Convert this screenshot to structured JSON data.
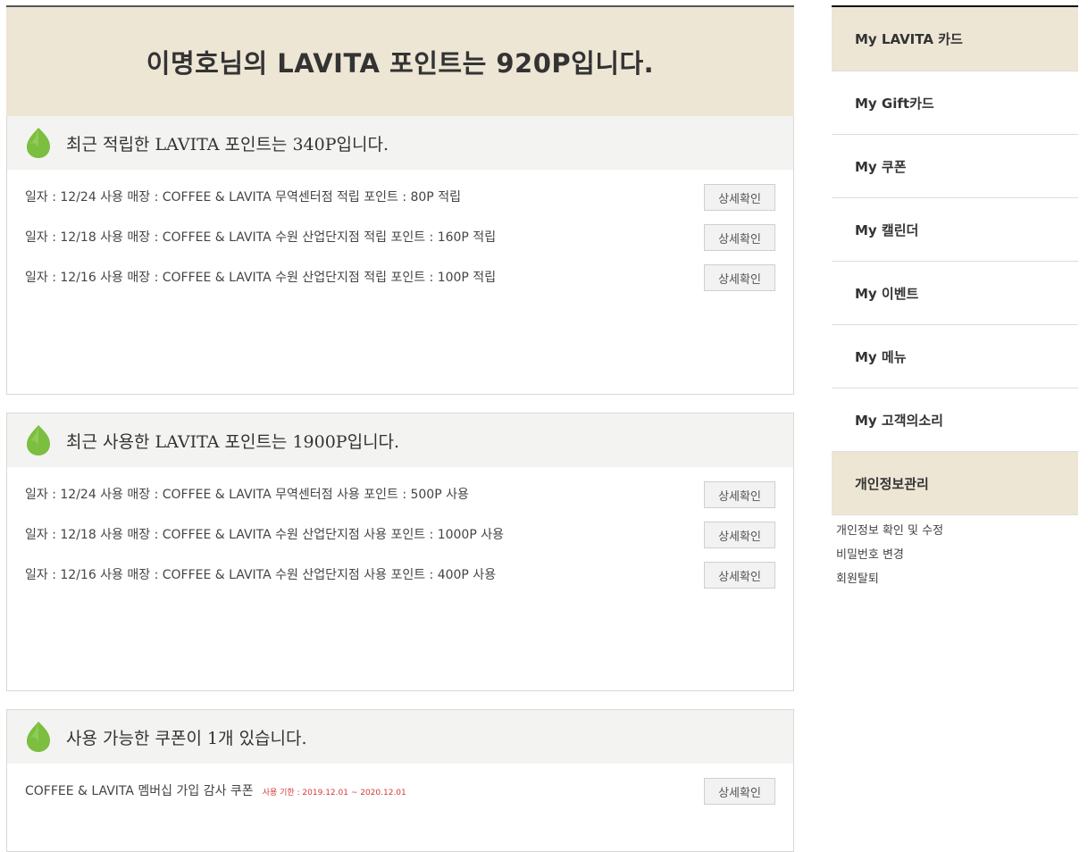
{
  "hero": {
    "title": "이명호님의 LAVITA 포인트는 920P입니다."
  },
  "earned": {
    "heading": "최근 적립한 LAVITA 포인트는 340P입니다.",
    "rows": [
      {
        "text": "일자 : 12/24 사용 매장 : COFFEE & LAVITA 무역센터점 적립 포인트 : 80P 적립",
        "button": "상세확인"
      },
      {
        "text": "일자 : 12/18 사용 매장 : COFFEE & LAVITA 수원 산업단지점 적립 포인트 : 160P 적립",
        "button": "상세확인"
      },
      {
        "text": "일자 : 12/16 사용 매장 : COFFEE & LAVITA 수원 산업단지점 적립 포인트 : 100P 적립",
        "button": "상세확인"
      }
    ]
  },
  "used": {
    "heading": "최근 사용한 LAVITA 포인트는 1900P입니다.",
    "rows": [
      {
        "text": "일자 : 12/24 사용 매장 : COFFEE & LAVITA 무역센터점 사용 포인트 : 500P 사용",
        "button": "상세확인"
      },
      {
        "text": "일자 : 12/18 사용 매장 : COFFEE & LAVITA 수원 산업단지점 사용 포인트 : 1000P 사용",
        "button": "상세확인"
      },
      {
        "text": "일자 : 12/16 사용 매장 : COFFEE & LAVITA 수원 산업단지점 사용 포인트 : 400P 사용",
        "button": "상세확인"
      }
    ]
  },
  "coupons": {
    "heading": "사용 가능한 쿠폰이 1개 있습니다.",
    "rows": [
      {
        "text": "COFFEE & LAVITA 멤버십 가입 감사 쿠폰",
        "note": "사용 기한 : 2019.12.01 ~ 2020.12.01",
        "button": "상세확인"
      }
    ]
  },
  "sidebar": {
    "items": [
      {
        "label": "My LAVITA 카드"
      },
      {
        "label": "My Gift카드"
      },
      {
        "label": "My 쿠폰"
      },
      {
        "label": "My 캘린더"
      },
      {
        "label": "My 이벤트"
      },
      {
        "label": "My 메뉴"
      },
      {
        "label": "My 고객의소리"
      },
      {
        "label": "개인정보관리"
      }
    ],
    "sub_links": [
      {
        "label": "개인정보 확인 및 수정"
      },
      {
        "label": "비밀번호 변경"
      },
      {
        "label": "회원탈퇴"
      }
    ]
  },
  "icons": {
    "section_icon": "leaf-icon"
  },
  "colors": {
    "accent_beige": "#ede6d5",
    "leaf_green": "#7cbe3f",
    "note_red": "#d43a3a"
  }
}
